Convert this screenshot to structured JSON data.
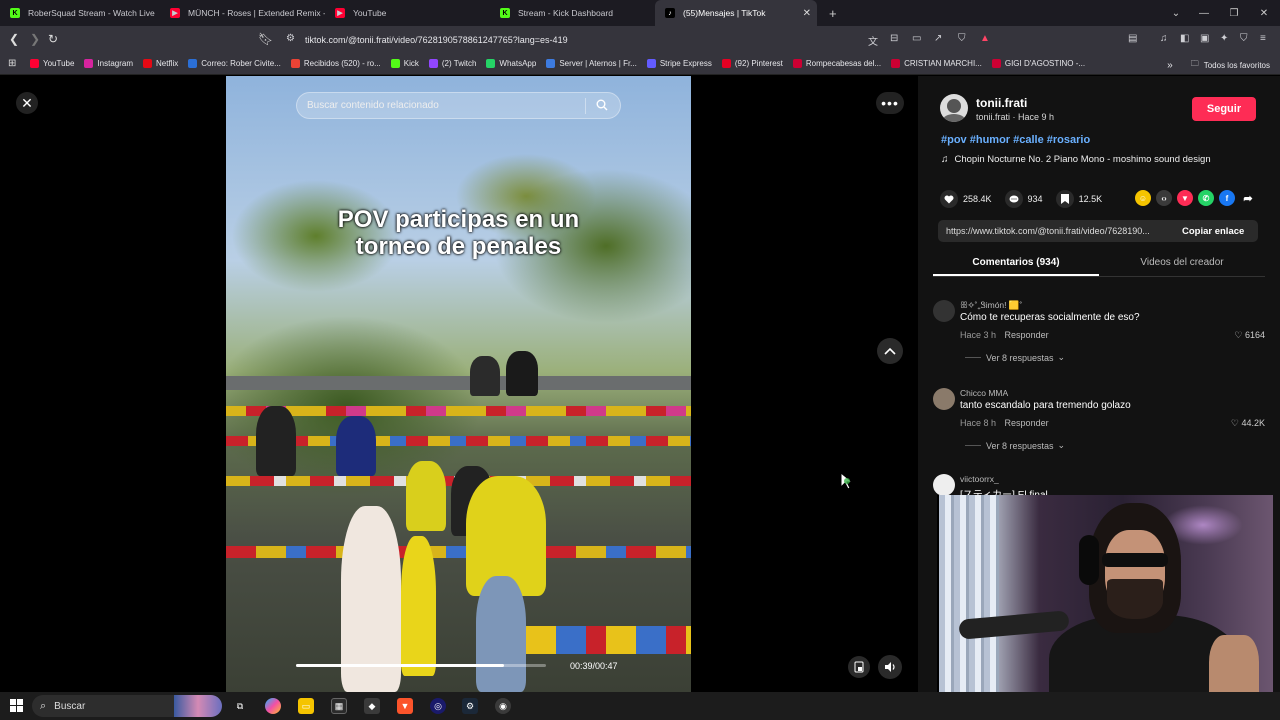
{
  "browser": {
    "tabs": [
      {
        "label": "RoberSquad Stream - Watch Live",
        "icon": "kick-icon",
        "color": "#53fc18"
      },
      {
        "label": "MÜNCH - Roses | Extended Remix - Y",
        "icon": "youtube-icon",
        "color": "#ff0033"
      },
      {
        "label": "YouTube",
        "icon": "youtube-icon",
        "color": "#ff0033"
      },
      {
        "label": "Stream - Kick Dashboard",
        "icon": "kick-icon",
        "color": "#53fc18"
      },
      {
        "label": "(55)Mensajes | TikTok",
        "icon": "tiktok-icon",
        "color": "#ffffff",
        "active": true
      }
    ],
    "url": "tiktok.com/@tonii.frati/video/7628190578861247765?lang=es-419",
    "bookmarks": [
      {
        "label": "YouTube",
        "color": "#ff0033"
      },
      {
        "label": "Instagram",
        "color": "#d6249f"
      },
      {
        "label": "Netflix",
        "color": "#e50914"
      },
      {
        "label": "Correo: Rober Civite...",
        "color": "#2b6fd6"
      },
      {
        "label": "Recibidos (520) - ro...",
        "color": "#ea4335"
      },
      {
        "label": "Kick",
        "color": "#53fc18"
      },
      {
        "label": "(2) Twitch",
        "color": "#9146ff"
      },
      {
        "label": "WhatsApp",
        "color": "#25d366"
      },
      {
        "label": "Server | Aternos | Fr...",
        "color": "#3d7be0"
      },
      {
        "label": "Stripe Express",
        "color": "#635bff"
      },
      {
        "label": "(92) Pinterest",
        "color": "#e60023"
      },
      {
        "label": "Rompecabesas del...",
        "color": "#cc0033"
      },
      {
        "label": "CRISTIAN MARCHI...",
        "color": "#cc0033"
      },
      {
        "label": "GIGI D'AGOSTINO -...",
        "color": "#cc0033"
      }
    ],
    "bookmarks_more": "Todos los favoritos"
  },
  "video": {
    "search_placeholder": "Buscar contenido relacionado",
    "caption_line1": "POV participas en un",
    "caption_line2": "torneo de penales",
    "time": "00:39/00:47",
    "progress_fraction": 0.83
  },
  "post": {
    "author_name": "tonii.frati",
    "author_meta": "tonii.frati · Hace 9 h",
    "follow_label": "Seguir",
    "hashtags": "#pov #humor #calle #rosario",
    "music": "Chopin Nocturne No. 2 Piano Mono - moshimo sound design",
    "likes": "258.4K",
    "comments": "934",
    "saves": "12.5K",
    "link": "https://www.tiktok.com/@tonii.frati/video/7628190...",
    "copy_label": "Copiar enlace",
    "tab_comments": "Comentarios (934)",
    "tab_creator": "Videos del creador"
  },
  "comments": [
    {
      "user": "ꕥ✧˚₊Ꮥimón! 🟨˚",
      "text": "Cómo te recuperas socialmente de eso?",
      "time": "Hace 3 h",
      "reply": "Responder",
      "likes": "6164",
      "more": "Ver 8 respuestas"
    },
    {
      "user": "Chicco MMA",
      "text": "tanto escandalo para tremendo golazo",
      "time": "Hace 8 h",
      "reply": "Responder",
      "likes": "44.2K",
      "more": "Ver 8 respuestas"
    },
    {
      "user": "viictoorrx_",
      "text": "[スティカー] El final"
    }
  ],
  "taskbar": {
    "search_label": "Buscar"
  }
}
